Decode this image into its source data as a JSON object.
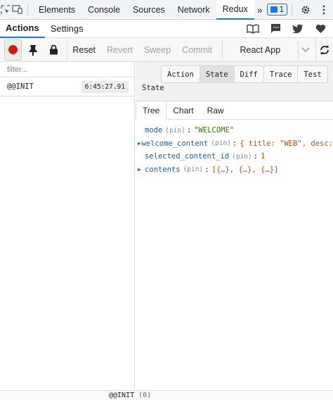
{
  "devtools": {
    "tabs": [
      {
        "label": "Elements"
      },
      {
        "label": "Console"
      },
      {
        "label": "Sources"
      },
      {
        "label": "Network"
      },
      {
        "label": "Redux"
      }
    ],
    "more_label": "»",
    "issues_count": "1",
    "settings_icon": "gear-icon",
    "kebab_icon": "kebab-icon"
  },
  "redux": {
    "tabs": [
      {
        "label": "Actions"
      },
      {
        "label": "Settings"
      }
    ],
    "header_icons": [
      "book-icon",
      "chat-icon",
      "twitter-icon",
      "heart-icon"
    ]
  },
  "toolbar": {
    "reset": "Reset",
    "revert": "Revert",
    "sweep": "Sweep",
    "commit": "Commit",
    "instance": "React App"
  },
  "actions": {
    "filter_placeholder": "filter...",
    "items": [
      {
        "name": "@@INIT",
        "time": "6:45:27.91"
      }
    ]
  },
  "inspector": {
    "modes": [
      "Action",
      "State",
      "Diff",
      "Trace",
      "Test"
    ],
    "active_mode": "State",
    "title": "State",
    "subtabs": [
      "Tree",
      "Chart",
      "Raw"
    ],
    "active_subtab": "Tree",
    "tree": [
      {
        "key": "mode",
        "pin": "(pin)",
        "value": "\"WELCOME\"",
        "expandable": false
      },
      {
        "key": "welcome_content",
        "pin": "(pin)",
        "value": "{ title: \"WEB\", desc:",
        "expandable": true
      },
      {
        "key": "selected_content_id",
        "pin": "(pin)",
        "value": "1",
        "expandable": false
      },
      {
        "key": "contents",
        "pin": "(pin)",
        "value": "[{…}, {…}, {…}]",
        "expandable": true
      }
    ]
  },
  "footer": {
    "label": "@@INIT",
    "count": "(0)"
  }
}
